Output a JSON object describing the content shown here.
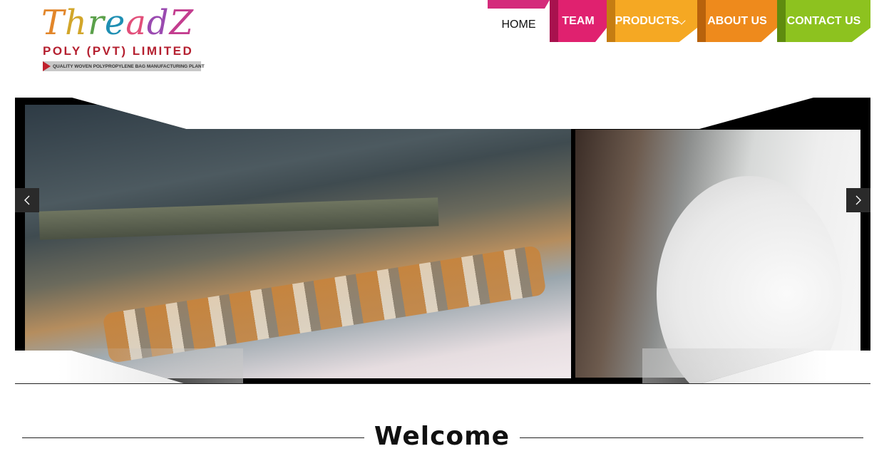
{
  "logo": {
    "wordmark": [
      "T",
      "h",
      "r",
      "e",
      "a",
      "d",
      "Z"
    ],
    "wordmark_colors": [
      "#e2862a",
      "#d2a62a",
      "#5aa04a",
      "#1f8fb3",
      "#e24f7a",
      "#9a4ab0",
      "#c33d8f"
    ],
    "subtitle": "POLY (PVT) LIMITED",
    "tagline": "QUALITY WOVEN POLYPROPYLENE BAG MANUFACTURING PLANT"
  },
  "nav": {
    "home": "HOME",
    "team": "TEAM",
    "products": "PRODUCTS",
    "about": "ABOUT US",
    "contact": "CONTACT US"
  },
  "colors": {
    "home_accent": "#d42b7b",
    "team": "#e0216f",
    "products": "#f5a823",
    "about": "#ee8a1c",
    "contact": "#8dc21f"
  },
  "slider": {
    "prev_icon": "chevron-left-icon",
    "next_icon": "chevron-right-icon"
  },
  "welcome": {
    "heading": "Welcome"
  }
}
